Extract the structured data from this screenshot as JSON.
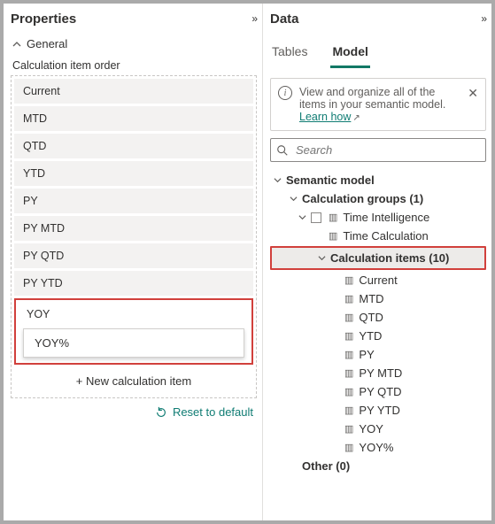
{
  "properties": {
    "title": "Properties",
    "section": "General",
    "field_label": "Calculation item order",
    "items": [
      "Current",
      "MTD",
      "QTD",
      "YTD",
      "PY",
      "PY MTD",
      "PY QTD",
      "PY YTD"
    ],
    "highlighted": {
      "yoy": "YOY",
      "yoy_pct": "YOY%"
    },
    "new_item": "+ New calculation item",
    "reset": "Reset to default"
  },
  "data": {
    "title": "Data",
    "tabs": {
      "tables": "Tables",
      "model": "Model"
    },
    "info": {
      "text": "View and organize all of the items in your semantic model.",
      "link": "Learn how"
    },
    "search_placeholder": "Search",
    "tree": {
      "root": "Semantic model",
      "calc_groups": "Calculation groups (1)",
      "time_intel": "Time Intelligence",
      "time_calc": "Time Calculation",
      "calc_items": "Calculation items (10)",
      "items": [
        "Current",
        "MTD",
        "QTD",
        "YTD",
        "PY",
        "PY MTD",
        "PY QTD",
        "PY YTD",
        "YOY",
        "YOY%"
      ],
      "other": "Other (0)"
    }
  }
}
